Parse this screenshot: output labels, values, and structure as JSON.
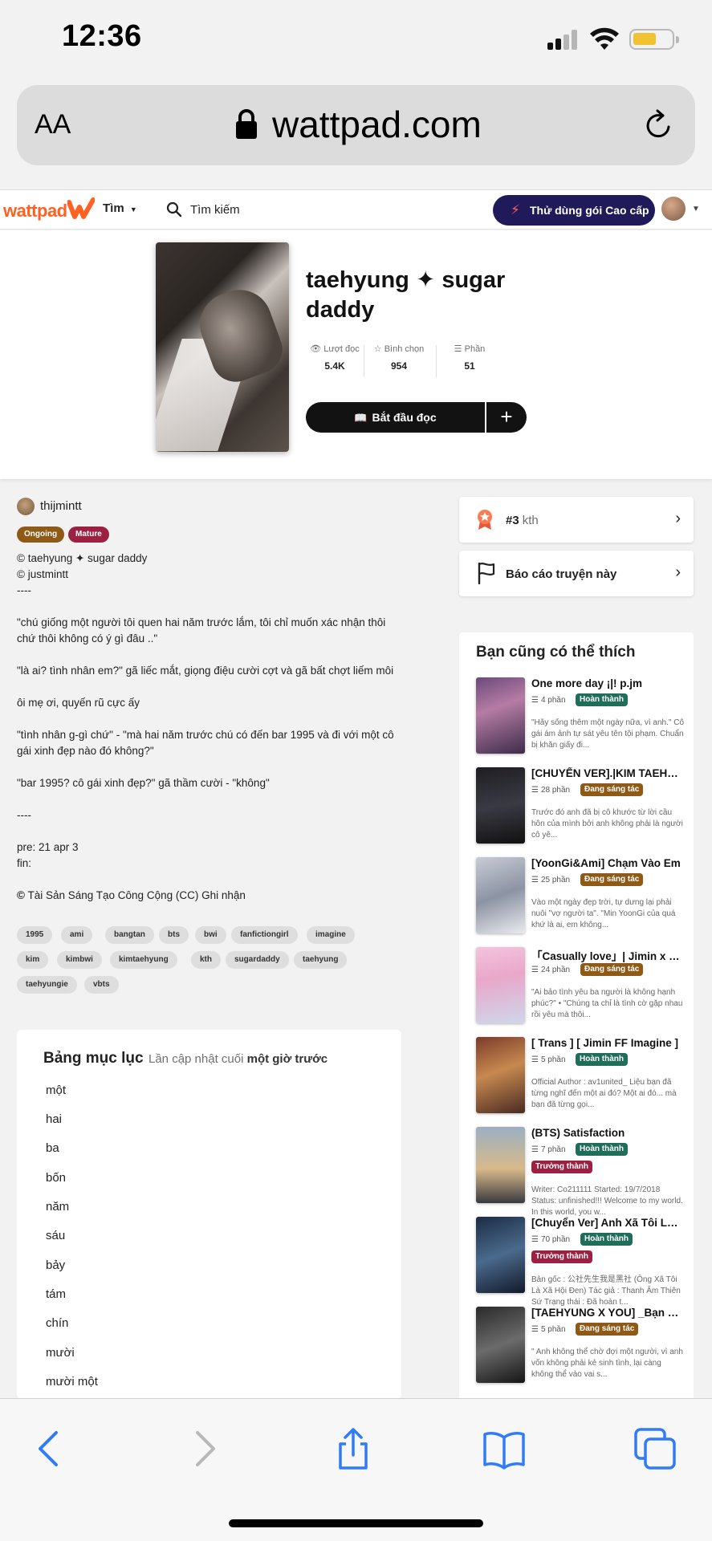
{
  "status_bar": {
    "time": "12:36"
  },
  "browser": {
    "text_size_label": "AA",
    "url": "wattpad.com"
  },
  "header": {
    "logo": "wattpad",
    "browse_label": "Tìm",
    "search_label": "Tìm kiếm",
    "premium_label": "Thử dùng gói Cao cấp"
  },
  "story": {
    "title": "taehyung ✦ sugar daddy",
    "stats": [
      {
        "label": "Lượt đọc",
        "value": "5.4K"
      },
      {
        "label": "Bình chọn",
        "value": "954"
      },
      {
        "label": "Phần",
        "value": "51"
      }
    ],
    "read_button": "Bắt đầu đọc",
    "add_button": "+",
    "author": "thijmintt",
    "status_tags": [
      "Ongoing",
      "Mature"
    ],
    "status_colors": [
      "#8e5a15",
      "#9b2042"
    ],
    "description": [
      "© taehyung ✦ sugar daddy",
      "© justmintt",
      "----",
      "",
      "\"chú giống một người tôi quen hai năm trước lắm, tôi chỉ muốn xác nhận thôi chứ thôi không có ý gì đâu ..\"",
      "",
      "\"là ai? tình nhân em?\" gã liếc mắt, giọng điệu cười cợt và gã bất chợt liếm môi",
      "",
      "ôi mẹ ơi, quyến rũ cực ấy",
      "",
      "\"tình nhân g-gì chứ\" - \"mà hai năm trước chú có đến bar 1995 và đi với một cô gái xinh đẹp nào đó không?\"",
      "",
      "\"bar 1995? cô gái xinh đẹp?\" gã thầm cười - \"không\"",
      "",
      "----",
      "",
      "pre: 21 apr 3",
      "fin:",
      ""
    ],
    "license": "Tài Sản Sáng Tạo Công Cộng (CC) Ghi nhận",
    "tags": [
      "1995",
      "ami",
      "bangtan",
      "bts",
      "bwi",
      "fanfictiongirl",
      "imagine",
      "kim",
      "kimbwi",
      "kimtaehyung",
      "kth",
      "sugardaddy",
      "taehyung",
      "taehyungie",
      "vbts"
    ]
  },
  "toc": {
    "title": "Bảng mục lục",
    "updated_prefix": "Lần cập nhật cuối",
    "updated_value": "một giờ trước",
    "chapters": [
      "một",
      "hai",
      "ba",
      "bốn",
      "năm",
      "sáu",
      "bảy",
      "tám",
      "chín",
      "mười",
      "mười một"
    ]
  },
  "sidebar": {
    "rank_number": "#3",
    "rank_tag": "kth",
    "report_label": "Báo cáo truyện này",
    "recommend_title": "Bạn cũng có thể thích",
    "recommendations": [
      {
        "title": "One more day ¡|! p.jm",
        "parts": "4 phần",
        "badges": [
          "Hoàn thành"
        ],
        "desc": "\"Hãy sống thêm một ngày nữa, vì anh.\" Cô gái ám ảnh tự sát yêu tên tội phạm. Chuẩn bị khăn giấy đi..."
      },
      {
        "title": "[CHUYỂN VER].|KIM TAEHYUNG|. Người Tình",
        "parts": "28 phần",
        "badges": [
          "Đang sáng tác"
        ],
        "desc": "Trước đó anh đã bị cô khước từ lời cầu hôn của mình bởi anh không phải là người cô yê..."
      },
      {
        "title": "[YoonGi&Ami] Chạm Vào Em",
        "parts": "25 phần",
        "badges": [
          "Đang sáng tác"
        ],
        "desc": "Vào một ngày đẹp trời, tự dưng lại phải nuôi \"vợ người ta\". \"Min YoonGi của quá khứ là ai, em không..."
      },
      {
        "title": "「Casually love」| Jimin x you",
        "parts": "24 phần",
        "badges": [
          "Đang sáng tác"
        ],
        "desc": "\"Ai bảo tình yêu ba người là không hạnh phúc?\" • \"Chúng ta chỉ là tình cờ gặp nhau rồi yêu mà thôi..."
      },
      {
        "title": "[ Trans ] [ Jimin FF Imagine ]",
        "parts": "5 phần",
        "badges": [
          "Hoàn thành"
        ],
        "desc": "Official Author : av1united_ Liệu bạn đã từng nghĩ đến một ai đó? Một ai đó... mà bạn đã từng gọi..."
      },
      {
        "title": "(BTS) Satisfaction",
        "parts": "7 phần",
        "badges": [
          "Hoàn thành",
          "Trưởng thành"
        ],
        "desc": "Writer: Co211111 Started: 19/7/2018 Status: unfinished!!! Welcome to my world. In this world, you w..."
      },
      {
        "title": "[Chuyển Ver] Anh Xã Tôi Là Xã Hội Đen",
        "parts": "70 phần",
        "badges": [
          "Hoàn thành",
          "Trưởng thành"
        ],
        "desc": "Bản gốc : 公社先生我是黑社 (Ông Xã Tôi Là Xã Hội Đen) Tác giả : Thanh Âm Thiên Sứ Trạng thái : Đã hoàn t..."
      },
      {
        "title": "[TAEHYUNG X YOU] _Bạn Trai Tôi",
        "parts": "5 phần",
        "badges": [
          "Đang sáng tác"
        ],
        "desc": "\" Anh không thể chờ đợi một người, vì anh vốn không phải kẻ sinh tình, lại càng không thể vào vai s..."
      }
    ]
  }
}
